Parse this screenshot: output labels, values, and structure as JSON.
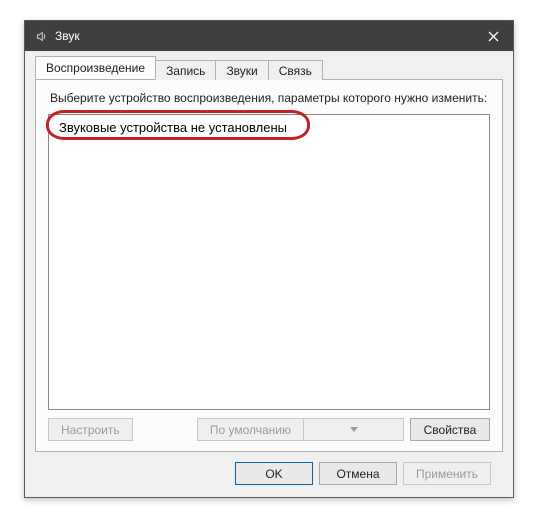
{
  "window": {
    "title": "Звук"
  },
  "tabs": {
    "playback": "Воспроизведение",
    "record": "Запись",
    "sounds": "Звуки",
    "comm": "Связь"
  },
  "panel": {
    "instruction": "Выберите устройство воспроизведения, параметры которого нужно изменить:",
    "no_devices": "Звуковые устройства не установлены",
    "configure": "Настроить",
    "set_default": "По умолчанию",
    "properties": "Свойства"
  },
  "footer": {
    "ok": "OK",
    "cancel": "Отмена",
    "apply": "Применить"
  }
}
